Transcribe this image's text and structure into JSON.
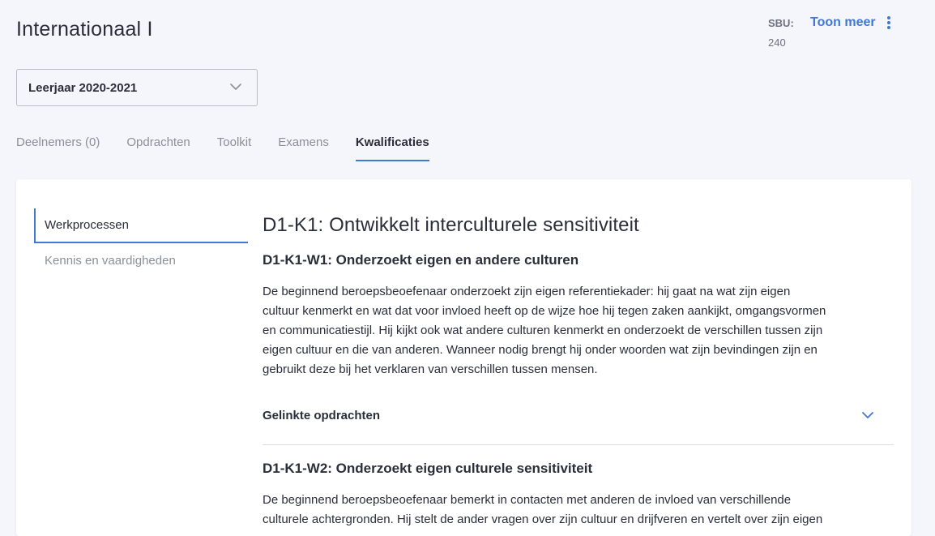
{
  "page": {
    "title": "Internationaal I"
  },
  "sbu": {
    "label": "SBU:",
    "value": "240"
  },
  "actions": {
    "more_label": "Toon meer"
  },
  "year_select": {
    "value": "Leerjaar 2020-2021"
  },
  "tabs": [
    {
      "label": "Deelnemers (0)",
      "active": false
    },
    {
      "label": "Opdrachten",
      "active": false
    },
    {
      "label": "Toolkit",
      "active": false
    },
    {
      "label": "Examens",
      "active": false
    },
    {
      "label": "Kwalificaties",
      "active": true
    }
  ],
  "side_nav": [
    {
      "label": "Werkprocessen",
      "active": true
    },
    {
      "label": "Kennis en vaardigheden",
      "active": false
    }
  ],
  "content": {
    "title": "D1-K1: Ontwikkelt interculturele sensitiviteit",
    "processes": [
      {
        "heading": "D1-K1-W1: Onderzoekt eigen en andere culturen",
        "lines": [
          "De beginnend beroepsbeoefenaar onderzoekt zijn eigen referentiekader: hij gaat na wat zijn eigen",
          "cultuur kenmerkt en wat dat voor invloed heeft op de wijze hoe hij tegen zaken aankijkt, omgangsvormen",
          "en communicatiestijl. Hij kijkt ook wat andere culturen kenmerkt en onderzoekt de verschillen tussen zijn",
          "eigen cultuur en die van anderen. Wanneer nodig brengt hij onder woorden wat zijn bevindingen zijn en",
          "gebruikt deze bij het verklaren van verschillen tussen mensen."
        ],
        "linked_label": "Gelinkte opdrachten"
      },
      {
        "heading": "D1-K1-W2: Onderzoekt eigen culturele sensitiviteit",
        "lines": [
          "De beginnend beroepsbeoefenaar bemerkt in contacten met anderen de invloed van verschillende",
          "culturele achtergronden. Hij stelt de ander vragen over zijn cultuur en drijfveren en vertelt over zijn eigen"
        ]
      }
    ]
  },
  "colors": {
    "accent": "#3f78d6",
    "text": "#2b2d3a",
    "muted": "#8b8e9c",
    "page_bg": "#f5f6fb",
    "card_bg": "#ffffff"
  },
  "icons": {
    "more": "vertical-dots-icon",
    "select_chevron": "chevron-down-icon",
    "accordion_chevron": "chevron-down-icon"
  }
}
